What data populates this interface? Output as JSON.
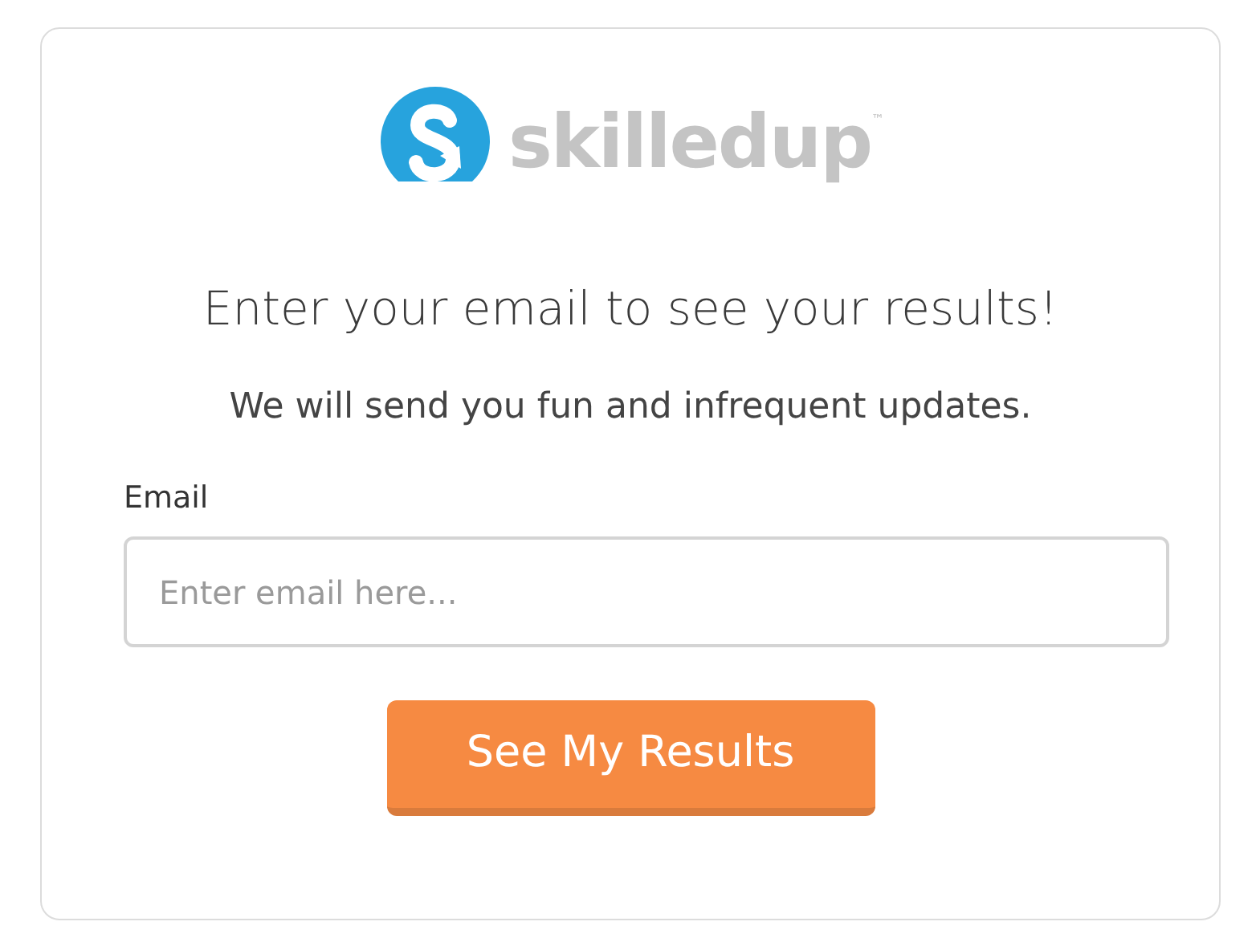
{
  "logo": {
    "wordmark": "skilledup",
    "trademark": "™"
  },
  "heading": "Enter your email to see your results!",
  "subheading": "We will send you fun and infrequent updates.",
  "email_field": {
    "label": "Email",
    "placeholder": "Enter email here..."
  },
  "submit_button": "See My Results"
}
